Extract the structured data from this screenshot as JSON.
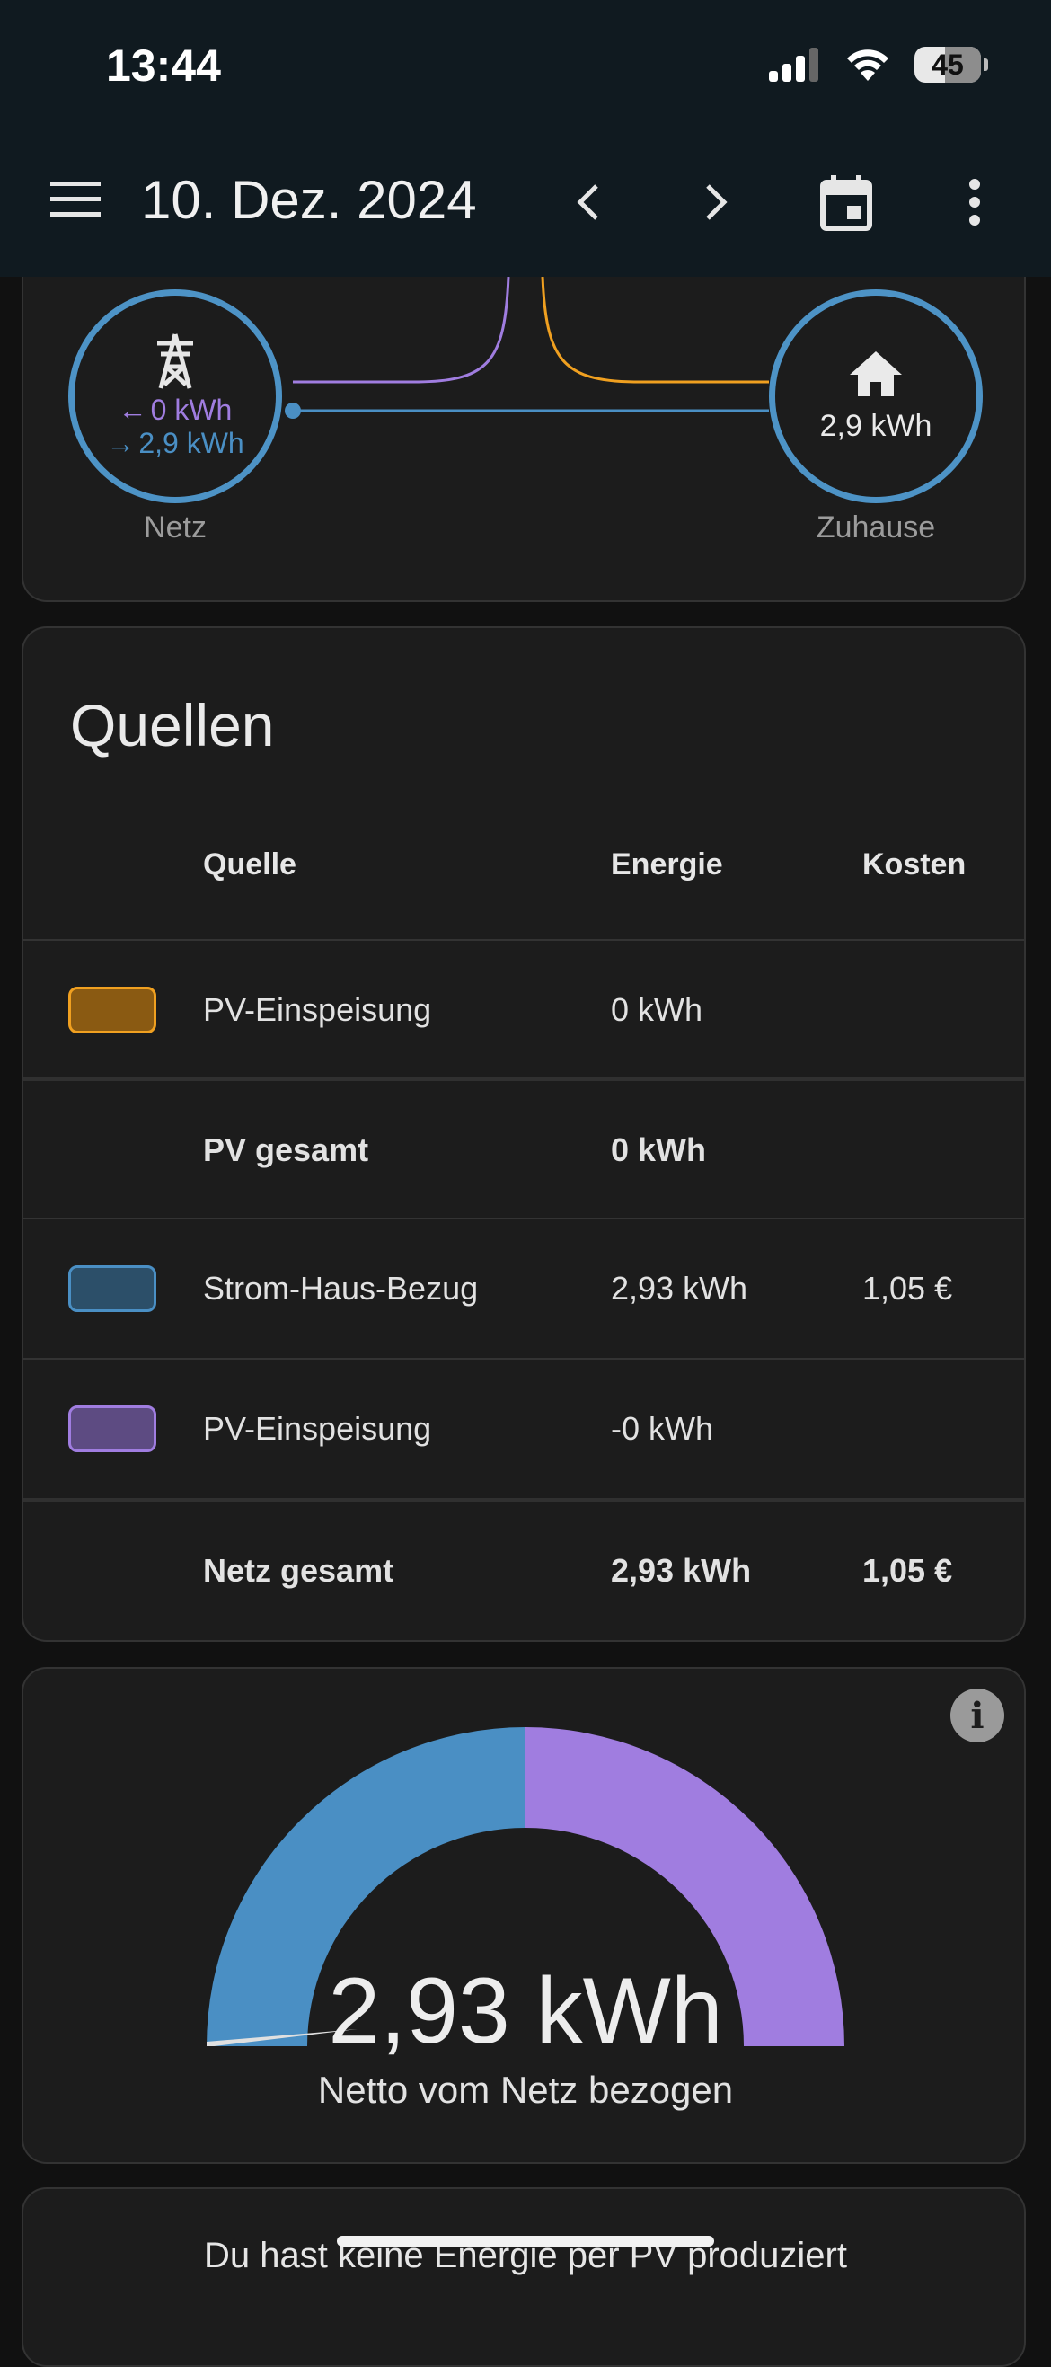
{
  "status_bar": {
    "time": "13:44",
    "battery": "45"
  },
  "app_bar": {
    "title": "10. Dez. 2024"
  },
  "flow": {
    "grid": {
      "in_value": "0 kWh",
      "out_value": "2,9 kWh",
      "label": "Netz"
    },
    "home": {
      "value": "2,9 kWh",
      "label": "Zuhause"
    }
  },
  "sources": {
    "title": "Quellen",
    "headers": {
      "source": "Quelle",
      "energy": "Energie",
      "cost": "Kosten"
    },
    "rows": [
      {
        "label": "PV-Einspeisung",
        "energy": "0 kWh",
        "cost": "",
        "color": "#f0a020",
        "fill": "#8a5a12"
      },
      {
        "label": "PV gesamt",
        "energy": "0 kWh",
        "cost": ""
      },
      {
        "label": "Strom-Haus-Bezug",
        "energy": "2,93 kWh",
        "cost": "1,05 €",
        "color": "#4a8fc4",
        "fill": "#2c4f69"
      },
      {
        "label": "PV-Einspeisung",
        "energy": "-0 kWh",
        "cost": "",
        "color": "#a07de0",
        "fill": "#5d4b82"
      },
      {
        "label": "Netz gesamt",
        "energy": "2,93 kWh",
        "cost": "1,05 €"
      }
    ]
  },
  "gauge": {
    "value": "2,93 kWh",
    "caption": "Netto vom Netz bezogen",
    "info": "i"
  },
  "bottom_card": {
    "text": "Du hast keine Energie per PV produziert"
  },
  "colors": {
    "solar": "#f0a020",
    "grid": "#4a8fc4",
    "return": "#a07de0"
  }
}
